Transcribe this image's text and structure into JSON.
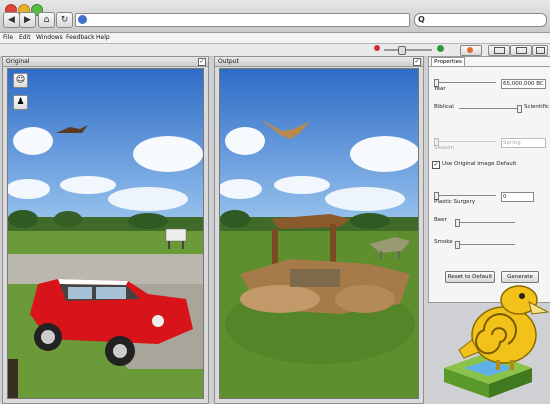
{
  "browser": {
    "search_glyph": "Q",
    "back_glyph": "◀",
    "forward_glyph": "▶",
    "home_glyph": "⌂",
    "reload_glyph": "↻"
  },
  "menu": [
    "File",
    "Edit",
    "Windows",
    "Feedback",
    "Help"
  ],
  "panels": {
    "original": {
      "title": "Original",
      "checked": "✓"
    },
    "output": {
      "title": "Output",
      "checked": "✓"
    }
  },
  "properties": {
    "tab": "Properties",
    "year_label": "Year",
    "year_value": "65,000,000 BC",
    "biblical_label": "Biblical",
    "scientific_label": "Scientific",
    "season_label": "Season",
    "season_value": "Spring",
    "use_original_label": "Use Original Image Default",
    "use_original_check": "✓",
    "plastic_label": "Plastic Surgery",
    "plastic_value": "0",
    "beer_label": "Beer",
    "smoke_label": "Smoke",
    "reset_label": "Reset to Default",
    "generate_label": "Generate"
  },
  "colors": {
    "sky": "#3f7fd1",
    "grass": "#5d8f2f",
    "car": "#d8141a"
  }
}
